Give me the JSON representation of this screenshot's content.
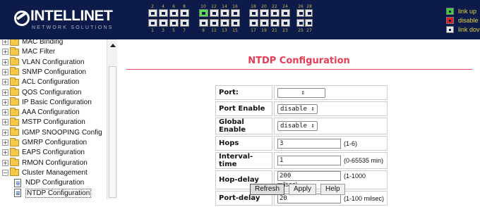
{
  "header": {
    "logo_text": "INTELLINET",
    "logo_sub": "NETWORK SOLUTIONS",
    "ports_top_numbers": [
      "2",
      "4",
      "6",
      "8",
      "10",
      "12",
      "14",
      "16",
      "18",
      "20",
      "22",
      "24",
      "26",
      "28"
    ],
    "ports_bottom_numbers": [
      "1",
      "3",
      "5",
      "7",
      "9",
      "11",
      "13",
      "15",
      "17",
      "19",
      "21",
      "23",
      "25",
      "27"
    ],
    "legend": [
      {
        "label": "link up",
        "color": "#3ccf3c"
      },
      {
        "label": "disable",
        "color": "#e02020"
      },
      {
        "label": "link dov",
        "color": "#e8e8e8"
      }
    ]
  },
  "sidebar": {
    "items": [
      {
        "label": "MAC Binding",
        "type": "folder"
      },
      {
        "label": "MAC Filter",
        "type": "folder"
      },
      {
        "label": "VLAN Configuration",
        "type": "folder"
      },
      {
        "label": "SNMP Configuration",
        "type": "folder"
      },
      {
        "label": "ACL Configuration",
        "type": "folder"
      },
      {
        "label": "QOS Configuration",
        "type": "folder"
      },
      {
        "label": "IP Basic Configuration",
        "type": "folder"
      },
      {
        "label": "AAA Configuration",
        "type": "folder"
      },
      {
        "label": "MSTP Configuration",
        "type": "folder"
      },
      {
        "label": "IGMP SNOOPING Config",
        "type": "folder"
      },
      {
        "label": "GMRP Configuration",
        "type": "folder"
      },
      {
        "label": "EAPS Configuration",
        "type": "folder"
      },
      {
        "label": "RMON Configuration",
        "type": "folder"
      },
      {
        "label": "Cluster Management",
        "type": "folder-open"
      },
      {
        "label": "NDP Configuration",
        "type": "doc"
      },
      {
        "label": "NTDP Configuration",
        "type": "doc"
      }
    ]
  },
  "main": {
    "title": "NTDP Configuration",
    "rows": [
      {
        "label": "Port:",
        "kind": "select",
        "value": "",
        "hint": ""
      },
      {
        "label": "Port Enable",
        "kind": "select",
        "value": "disable",
        "hint": ""
      },
      {
        "label": "Global Enable",
        "kind": "select",
        "value": "disable",
        "hint": ""
      },
      {
        "label": "Hops",
        "kind": "input",
        "value": "3",
        "hint": "(1-6)"
      },
      {
        "label": "Interval-time",
        "kind": "input",
        "value": "1",
        "hint": "(0-65535 min)"
      },
      {
        "label": "Hop-delay",
        "kind": "input",
        "value": "200",
        "hint": "(1-1000 milsec)"
      },
      {
        "label": "Port-delay",
        "kind": "input",
        "value": "20",
        "hint": "(1-100 milsec)"
      }
    ],
    "buttons": {
      "refresh": "Refresh",
      "apply": "Apply",
      "help": "Help"
    }
  }
}
